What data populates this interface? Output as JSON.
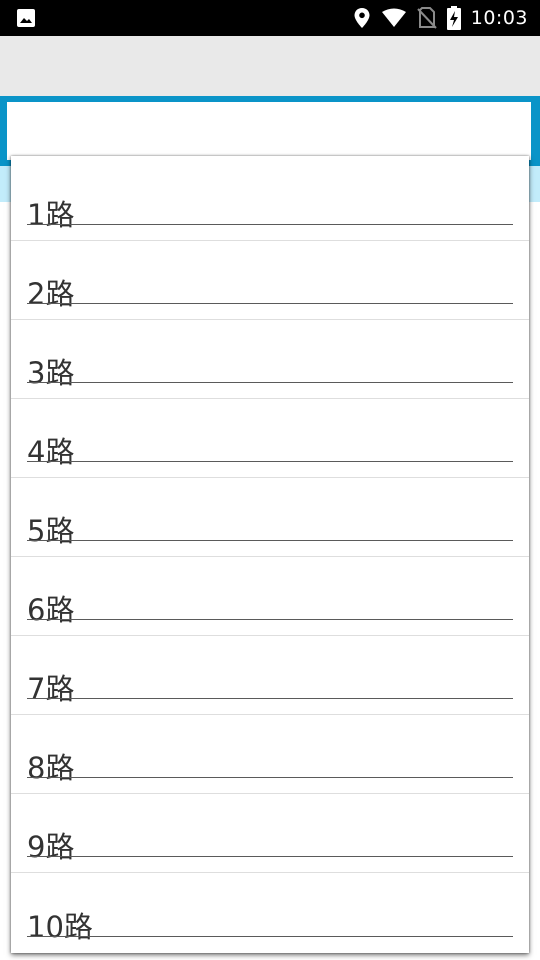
{
  "status_bar": {
    "time": "10:03",
    "icons": [
      "gallery-icon",
      "location-pin-icon",
      "wifi-icon",
      "no-sim-icon",
      "battery-charging-icon"
    ]
  },
  "search": {
    "value": "",
    "placeholder": ""
  },
  "dropdown": {
    "items": [
      {
        "label": "1路"
      },
      {
        "label": "2路"
      },
      {
        "label": "3路"
      },
      {
        "label": "4路"
      },
      {
        "label": "5路"
      },
      {
        "label": "6路"
      },
      {
        "label": "7路"
      },
      {
        "label": "8路"
      },
      {
        "label": "9路"
      },
      {
        "label": "10路"
      }
    ]
  },
  "colors": {
    "status_bar": "#000000",
    "app_bar": "#e9e9e9",
    "search_frame": "#0a94c8",
    "light_strip": "#c2ecfb",
    "text": "#333333"
  }
}
